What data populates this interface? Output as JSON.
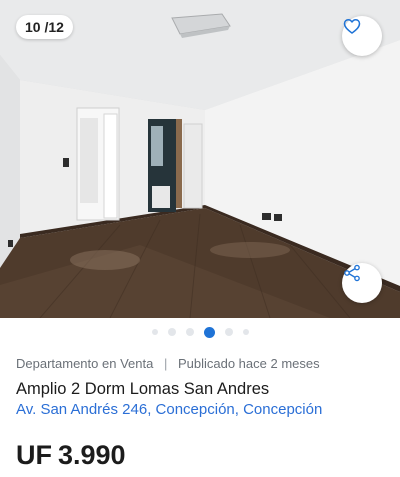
{
  "gallery": {
    "counter": "10 /12",
    "favorite_icon": "heart-outline-icon",
    "share_icon": "share-icon",
    "image_count": 12,
    "current_index": 10,
    "dots": [
      {
        "state": "small"
      },
      {
        "state": "normal"
      },
      {
        "state": "normal"
      },
      {
        "state": "active"
      },
      {
        "state": "normal"
      },
      {
        "state": "small"
      }
    ]
  },
  "listing": {
    "property_type": "Departamento en Venta",
    "separator": "|",
    "published": "Publicado hace 2 meses",
    "title": "Amplio 2 Dorm Lomas San Andres",
    "address": "Av. San Andrés 246, Concepción, Concepción",
    "price_currency": "UF",
    "price_value": "3.990"
  },
  "colors": {
    "accent": "#1f73d6",
    "link": "#2b6fd6",
    "text": "#1c1c1c",
    "muted": "#6b7178"
  }
}
